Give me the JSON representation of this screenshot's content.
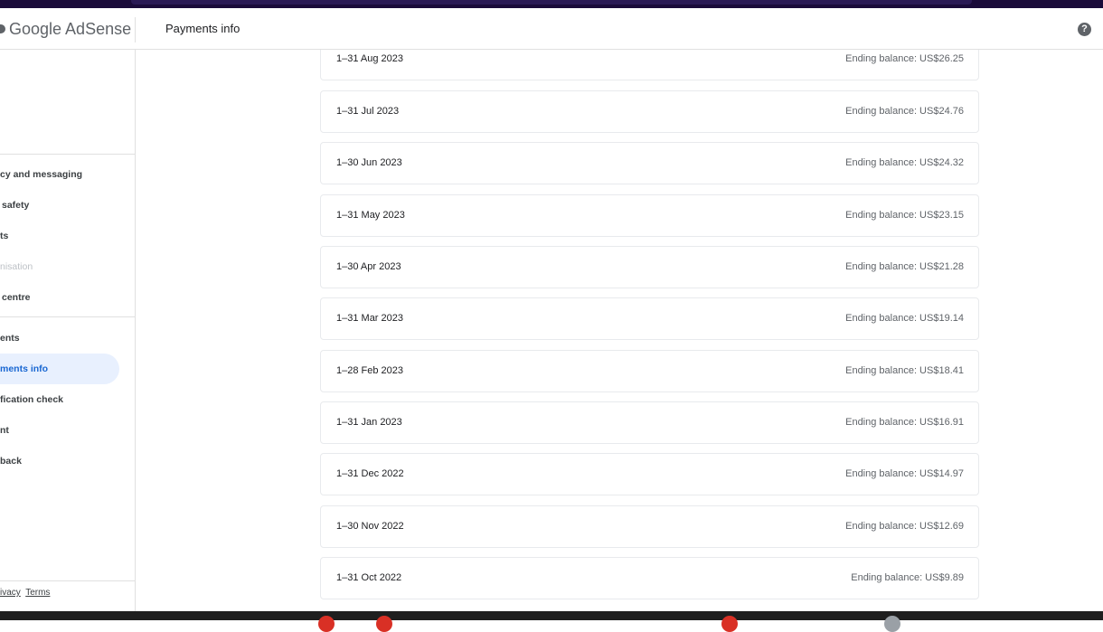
{
  "header": {
    "logo_text": "Google AdSense",
    "page_title": "Payments info",
    "help_icon": "help-circle-icon"
  },
  "sidebar": {
    "items": [
      {
        "label": "Privacy and messaging",
        "visible": "cy and messaging"
      },
      {
        "label": "Brand safety",
        "visible": "safety"
      },
      {
        "label": "Reports",
        "visible": "ts"
      },
      {
        "label": "Optimisation",
        "visible": "nisation"
      },
      {
        "label": "Policy centre",
        "visible": "centre"
      },
      {
        "label": "Payments",
        "visible": "ents"
      },
      {
        "label": "Payments info",
        "visible": "ments info"
      },
      {
        "label": "Verification check",
        "visible": "fication check"
      },
      {
        "label": "Account",
        "visible": "nt"
      },
      {
        "label": "Feedback",
        "visible": "back"
      }
    ],
    "footer": {
      "privacy": "ivacy",
      "terms": "Terms"
    }
  },
  "statements": [
    {
      "period": "1–31 Aug 2023",
      "balance": "Ending balance: US$26.25"
    },
    {
      "period": "1–31 Jul 2023",
      "balance": "Ending balance: US$24.76"
    },
    {
      "period": "1–30 Jun 2023",
      "balance": "Ending balance: US$24.32"
    },
    {
      "period": "1–31 May 2023",
      "balance": "Ending balance: US$23.15"
    },
    {
      "period": "1–30 Apr 2023",
      "balance": "Ending balance: US$21.28"
    },
    {
      "period": "1–31 Mar 2023",
      "balance": "Ending balance: US$19.14"
    },
    {
      "period": "1–28 Feb 2023",
      "balance": "Ending balance: US$18.41"
    },
    {
      "period": "1–31 Jan 2023",
      "balance": "Ending balance: US$16.91"
    },
    {
      "period": "1–31 Dec 2022",
      "balance": "Ending balance: US$14.97"
    },
    {
      "period": "1–30 Nov 2022",
      "balance": "Ending balance: US$12.69"
    },
    {
      "period": "1–31 Oct 2022",
      "balance": "Ending balance: US$9.89"
    }
  ],
  "colors": {
    "accent": "#1967d2",
    "active_bg": "#e8f0fe",
    "border": "#e0e0e0"
  }
}
